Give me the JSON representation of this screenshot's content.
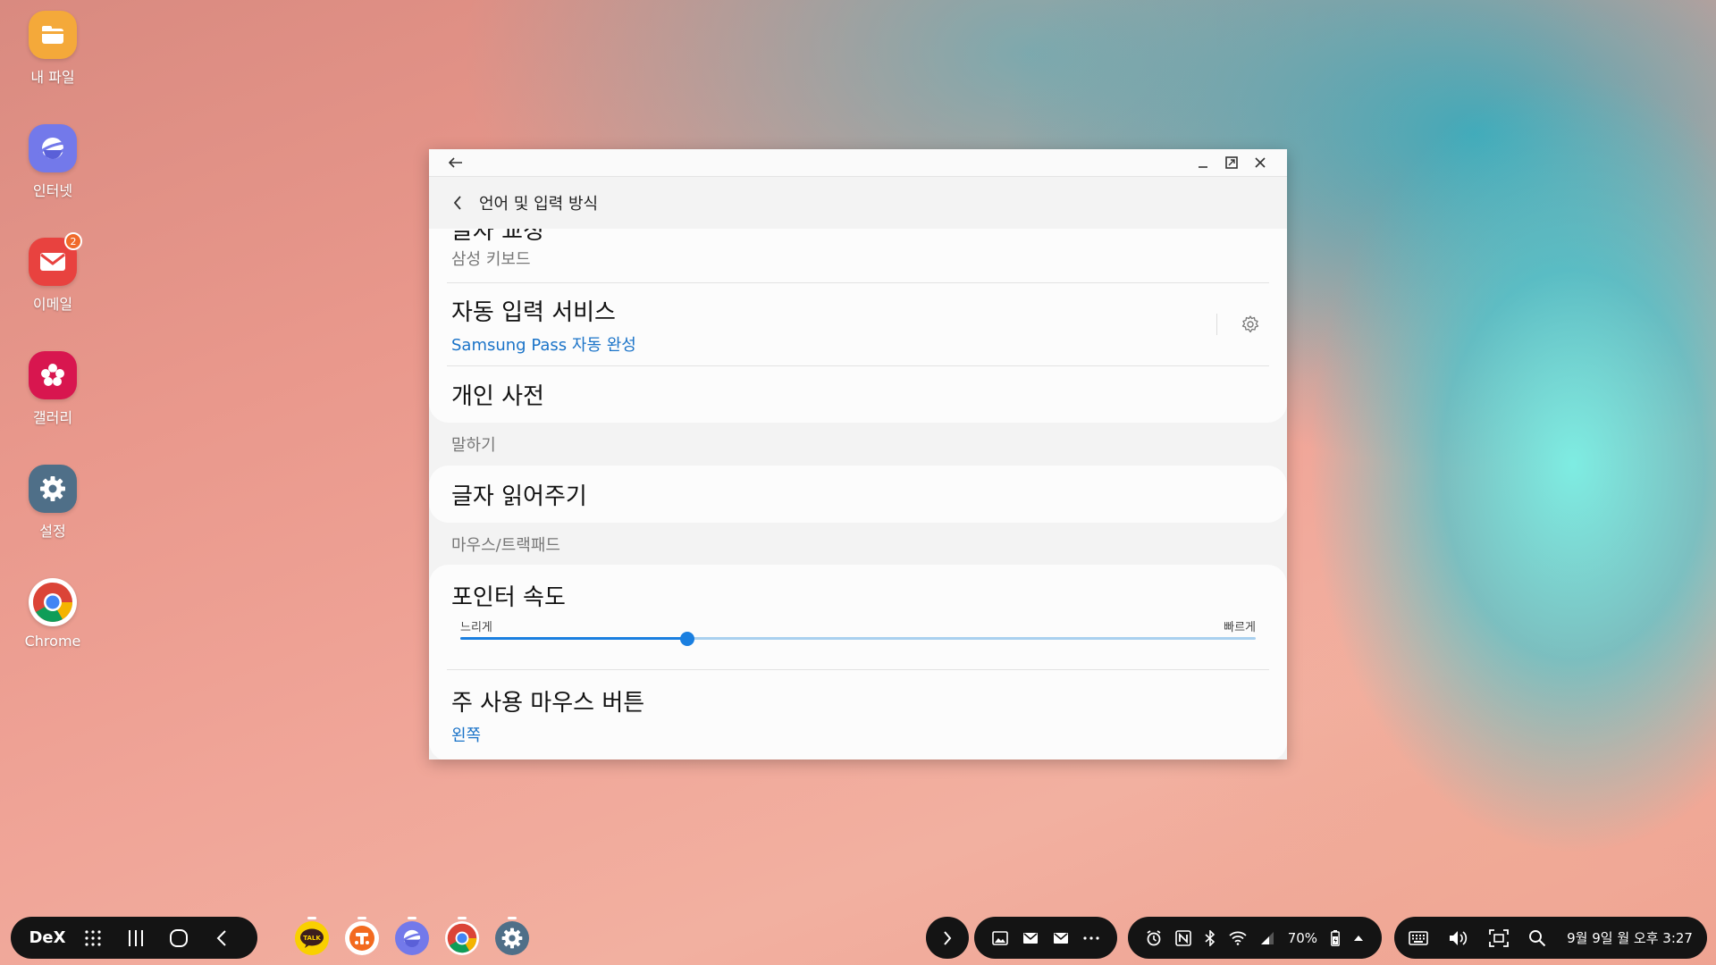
{
  "desktop": {
    "icons": [
      {
        "label": "내 파일",
        "icon": "folder-icon",
        "color": "#f2a732"
      },
      {
        "label": "인터넷",
        "icon": "internet-planet-icon",
        "color": "#6a6fe0"
      },
      {
        "label": "이메일",
        "icon": "mail-icon",
        "color": "#e8423f",
        "badge": "2"
      },
      {
        "label": "갤러리",
        "icon": "flower-icon",
        "color": "#d6174f"
      },
      {
        "label": "설정",
        "icon": "gear-icon",
        "color": "#4b6f8c"
      },
      {
        "label": "Chrome",
        "icon": "chrome-icon",
        "color": "#ffffff"
      }
    ]
  },
  "window": {
    "header_title": "언어 및 입력 방식",
    "items": {
      "partial_title": "글자 교정",
      "partial_sub": "삼성 키보드",
      "autofill_title": "자동 입력 서비스",
      "autofill_sub": "Samsung Pass 자동 완성",
      "dictionary_title": "개인 사전"
    },
    "section_speech": "말하기",
    "tts_title": "글자 읽어주기",
    "section_mouse": "마우스/트랙패드",
    "pointer_speed": {
      "title": "포인터 속도",
      "min_label": "느리게",
      "max_label": "빠르게",
      "value": 0.285
    },
    "primary_button": {
      "title": "주 사용 마우스 버튼",
      "value": "왼쪽"
    }
  },
  "taskbar": {
    "dex_label": "DeX",
    "battery": "70%",
    "datetime": "9월 9일 월 오후 3:27",
    "dock_apps": [
      "kakaotalk-icon",
      "tmap-icon",
      "internet-planet-icon",
      "chrome-icon",
      "gear-icon"
    ]
  }
}
